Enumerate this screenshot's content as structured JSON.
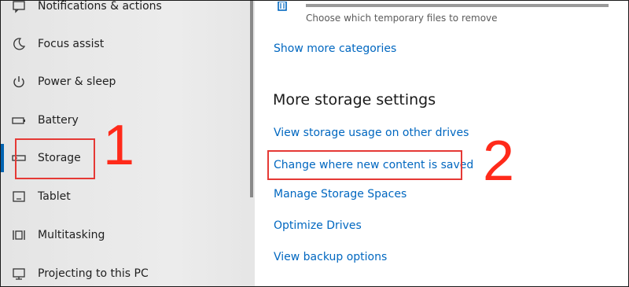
{
  "sidebar": {
    "items": [
      {
        "label": "Notifications & actions",
        "icon": "notifications-icon"
      },
      {
        "label": "Focus assist",
        "icon": "moon-icon"
      },
      {
        "label": "Power & sleep",
        "icon": "power-icon"
      },
      {
        "label": "Battery",
        "icon": "battery-icon"
      },
      {
        "label": "Storage",
        "icon": "storage-icon",
        "active": true
      },
      {
        "label": "Tablet",
        "icon": "tablet-icon"
      },
      {
        "label": "Multitasking",
        "icon": "multitasking-icon"
      },
      {
        "label": "Projecting to this PC",
        "icon": "projecting-icon"
      }
    ],
    "annotation_number": "1"
  },
  "main": {
    "temp_files_description": "Choose which temporary files to remove",
    "show_more_link": "Show more categories",
    "more_storage_heading": "More storage settings",
    "links": [
      "View storage usage on other drives",
      "Change where new content is saved",
      "Manage Storage Spaces",
      "Optimize Drives",
      "View backup options"
    ],
    "annotation_number": "2"
  },
  "colors": {
    "accent": "#0067c0",
    "annotation_red": "#e53935"
  }
}
